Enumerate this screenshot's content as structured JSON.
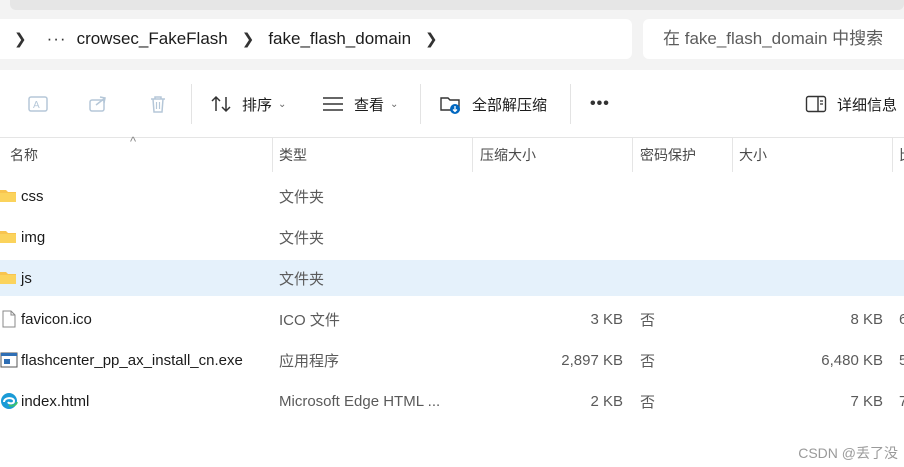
{
  "breadcrumb": {
    "more": "···",
    "items": [
      "crowsec_FakeFlash",
      "fake_flash_domain"
    ]
  },
  "search": {
    "placeholder": "在 fake_flash_domain 中搜索"
  },
  "toolbar": {
    "sort_label": "排序",
    "view_label": "查看",
    "extract_label": "全部解压缩",
    "more_label": "•••",
    "details_label": "详细信息"
  },
  "columns": {
    "name": "名称",
    "type": "类型",
    "compressed": "压缩大小",
    "protected": "密码保护",
    "size": "大小",
    "ratio_partial": "比"
  },
  "files": [
    {
      "name": "css",
      "type": "文件夹",
      "compressed": "",
      "protected": "",
      "size": "",
      "ratio": "",
      "icon": "folder-icon"
    },
    {
      "name": "img",
      "type": "文件夹",
      "compressed": "",
      "protected": "",
      "size": "",
      "ratio": "",
      "icon": "folder-icon"
    },
    {
      "name": "js",
      "type": "文件夹",
      "compressed": "",
      "protected": "",
      "size": "",
      "ratio": "",
      "icon": "folder-icon",
      "selected": true
    },
    {
      "name": "favicon.ico",
      "type": "ICO 文件",
      "compressed": "3 KB",
      "protected": "否",
      "size": "8 KB",
      "ratio": "6",
      "icon": "file-icon"
    },
    {
      "name": "flashcenter_pp_ax_install_cn.exe",
      "type": "应用程序",
      "compressed": "2,897 KB",
      "protected": "否",
      "size": "6,480 KB",
      "ratio": "5",
      "icon": "exe-icon"
    },
    {
      "name": "index.html",
      "type": "Microsoft Edge HTML ...",
      "compressed": "2 KB",
      "protected": "否",
      "size": "7 KB",
      "ratio": "7",
      "icon": "edge-icon"
    }
  ],
  "watermark": "CSDN @丢了没",
  "colors": {
    "selected_row": "#e5f1fb",
    "folder": "#f8c44f",
    "accent": "#0067c0"
  }
}
